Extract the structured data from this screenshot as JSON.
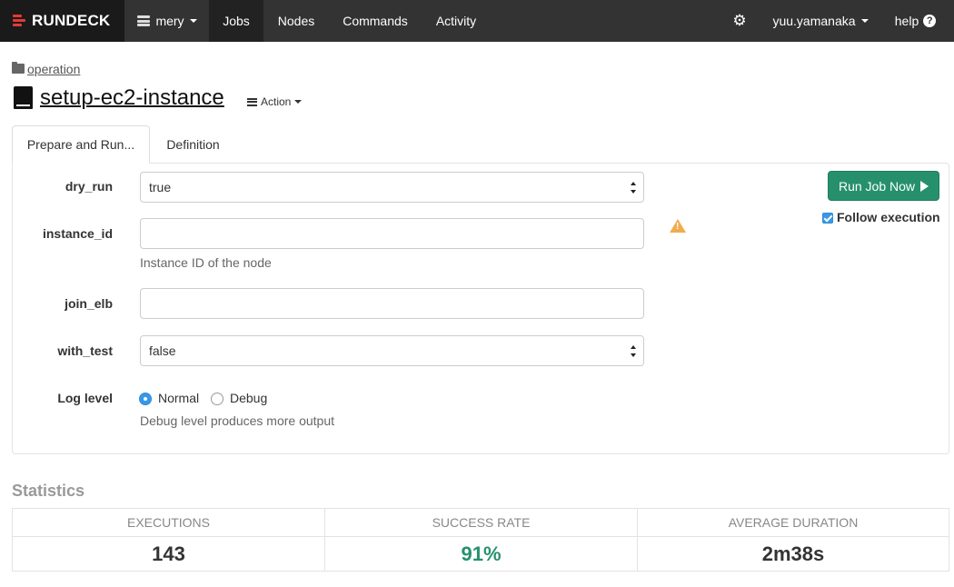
{
  "colors": {
    "navbar": "#333333",
    "accent": "#26906d",
    "brand_red": "#e53935",
    "warning": "#f0ad4e"
  },
  "navbar": {
    "brand": "RUNDECK",
    "project": "mery",
    "links": [
      "Jobs",
      "Nodes",
      "Commands",
      "Activity"
    ],
    "active_link": "Jobs",
    "user": "yuu.yamanaka",
    "help": "help",
    "icons": {
      "settings": "gear-icon",
      "project": "server-stack-icon",
      "help": "question-circle-icon"
    }
  },
  "job": {
    "group": "operation",
    "title": "setup-ec2-instance",
    "action_label": "Action"
  },
  "tabs": [
    "Prepare and Run...",
    "Definition"
  ],
  "form": {
    "options": [
      {
        "label": "dry_run",
        "type": "select",
        "value": "true"
      },
      {
        "label": "instance_id",
        "type": "text",
        "value": "",
        "help": "Instance ID of the node",
        "warning": true
      },
      {
        "label": "join_elb",
        "type": "text",
        "value": ""
      },
      {
        "label": "with_test",
        "type": "select",
        "value": "false"
      }
    ],
    "log_level": {
      "label": "Log level",
      "choices": [
        "Normal",
        "Debug"
      ],
      "selected": "Normal",
      "help": "Debug level produces more output"
    }
  },
  "run": {
    "button_label": "Run Job Now",
    "follow_label": "Follow execution",
    "follow_checked": true
  },
  "statistics": {
    "title": "Statistics",
    "columns": [
      {
        "label": "EXECUTIONS",
        "value": "143"
      },
      {
        "label": "SUCCESS RATE",
        "value": "91%"
      },
      {
        "label": "AVERAGE DURATION",
        "value": "2m38s"
      }
    ]
  }
}
